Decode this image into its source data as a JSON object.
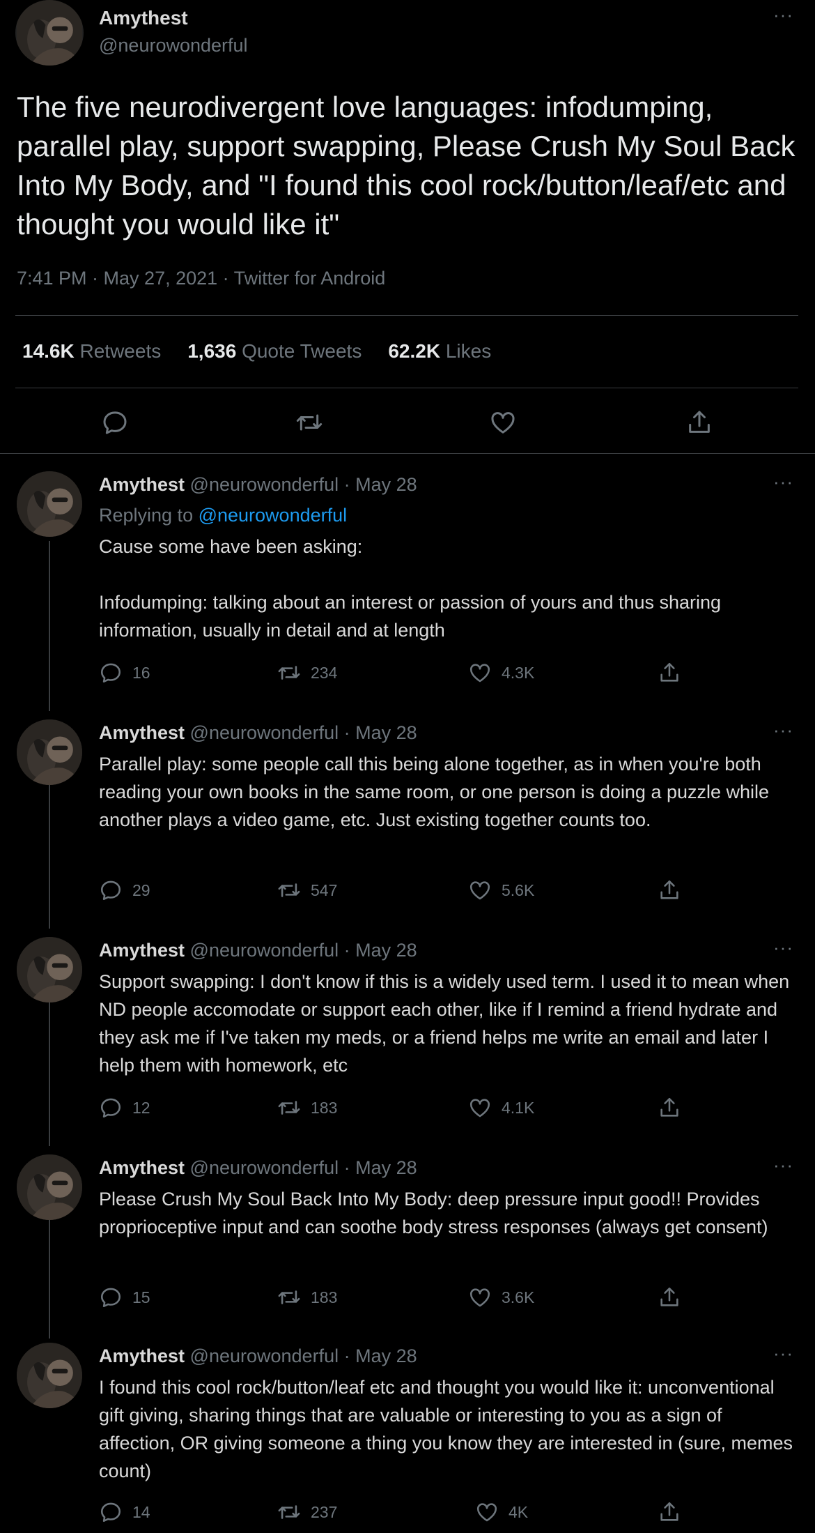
{
  "main": {
    "author_name": "Amythest",
    "author_handle": "@neurowonderful",
    "text": "The five neurodivergent love languages: infodumping, parallel play, support swapping, Please Crush My Soul Back Into My Body, and \"I found this cool rock/button/leaf/etc and thought you would like it\"",
    "timestamp": "7:41 PM · May 27, 2021 · Twitter for Android",
    "stats": {
      "retweets_count": "14.6K",
      "retweets_label": "Retweets",
      "quotes_count": "1,636",
      "quotes_label": "Quote Tweets",
      "likes_count": "62.2K",
      "likes_label": "Likes"
    },
    "more_label": "···"
  },
  "replies": [
    {
      "name": "Amythest",
      "meta": "@neurowonderful · May 28",
      "replying_prefix": "Replying to ",
      "replying_handle": "@neurowonderful",
      "text": "Cause some have been asking:\n\nInfodumping: talking about an interest or passion of yours and thus sharing information, usually in detail and at length",
      "replies": "16",
      "retweets": "234",
      "likes": "4.3K"
    },
    {
      "name": "Amythest",
      "meta": "@neurowonderful · May 28",
      "text": "Parallel play: some people call this being alone together, as in when you're both reading your own books in the same room, or one person is doing a puzzle while another plays a video game, etc. Just existing together counts too.",
      "replies": "29",
      "retweets": "547",
      "likes": "5.6K"
    },
    {
      "name": "Amythest",
      "meta": "@neurowonderful · May 28",
      "text": "Support swapping: I don't know if this is a widely used term. I used it to mean when ND people accomodate or support each other, like if I remind a friend hydrate and they ask me if I've taken my meds, or a friend helps me write an email and later I help them with homework, etc",
      "replies": "12",
      "retweets": "183",
      "likes": "4.1K"
    },
    {
      "name": "Amythest",
      "meta": "@neurowonderful · May 28",
      "text": "Please Crush My Soul Back Into My Body: deep pressure input good!! Provides proprioceptive input and can soothe body stress responses (always get consent)",
      "replies": "15",
      "retweets": "183",
      "likes": "3.6K"
    },
    {
      "name": "Amythest",
      "meta": "@neurowonderful · May 28",
      "text": "I found this cool rock/button/leaf etc and thought you would like it: unconventional gift giving, sharing things that are valuable or interesting to you as a sign of affection, OR giving someone a thing you know they are interested in (sure, memes count)",
      "replies": "14",
      "retweets": "237",
      "likes": "4K"
    }
  ],
  "icons": {
    "reply": "reply-icon",
    "retweet": "retweet-icon",
    "like": "heart-icon",
    "share": "share-icon",
    "more": "more-icon"
  },
  "colors": {
    "background": "#000000",
    "text": "#d9d9d9",
    "muted": "#6e767d",
    "link": "#1d9bf0",
    "divider": "#3a3d40"
  }
}
